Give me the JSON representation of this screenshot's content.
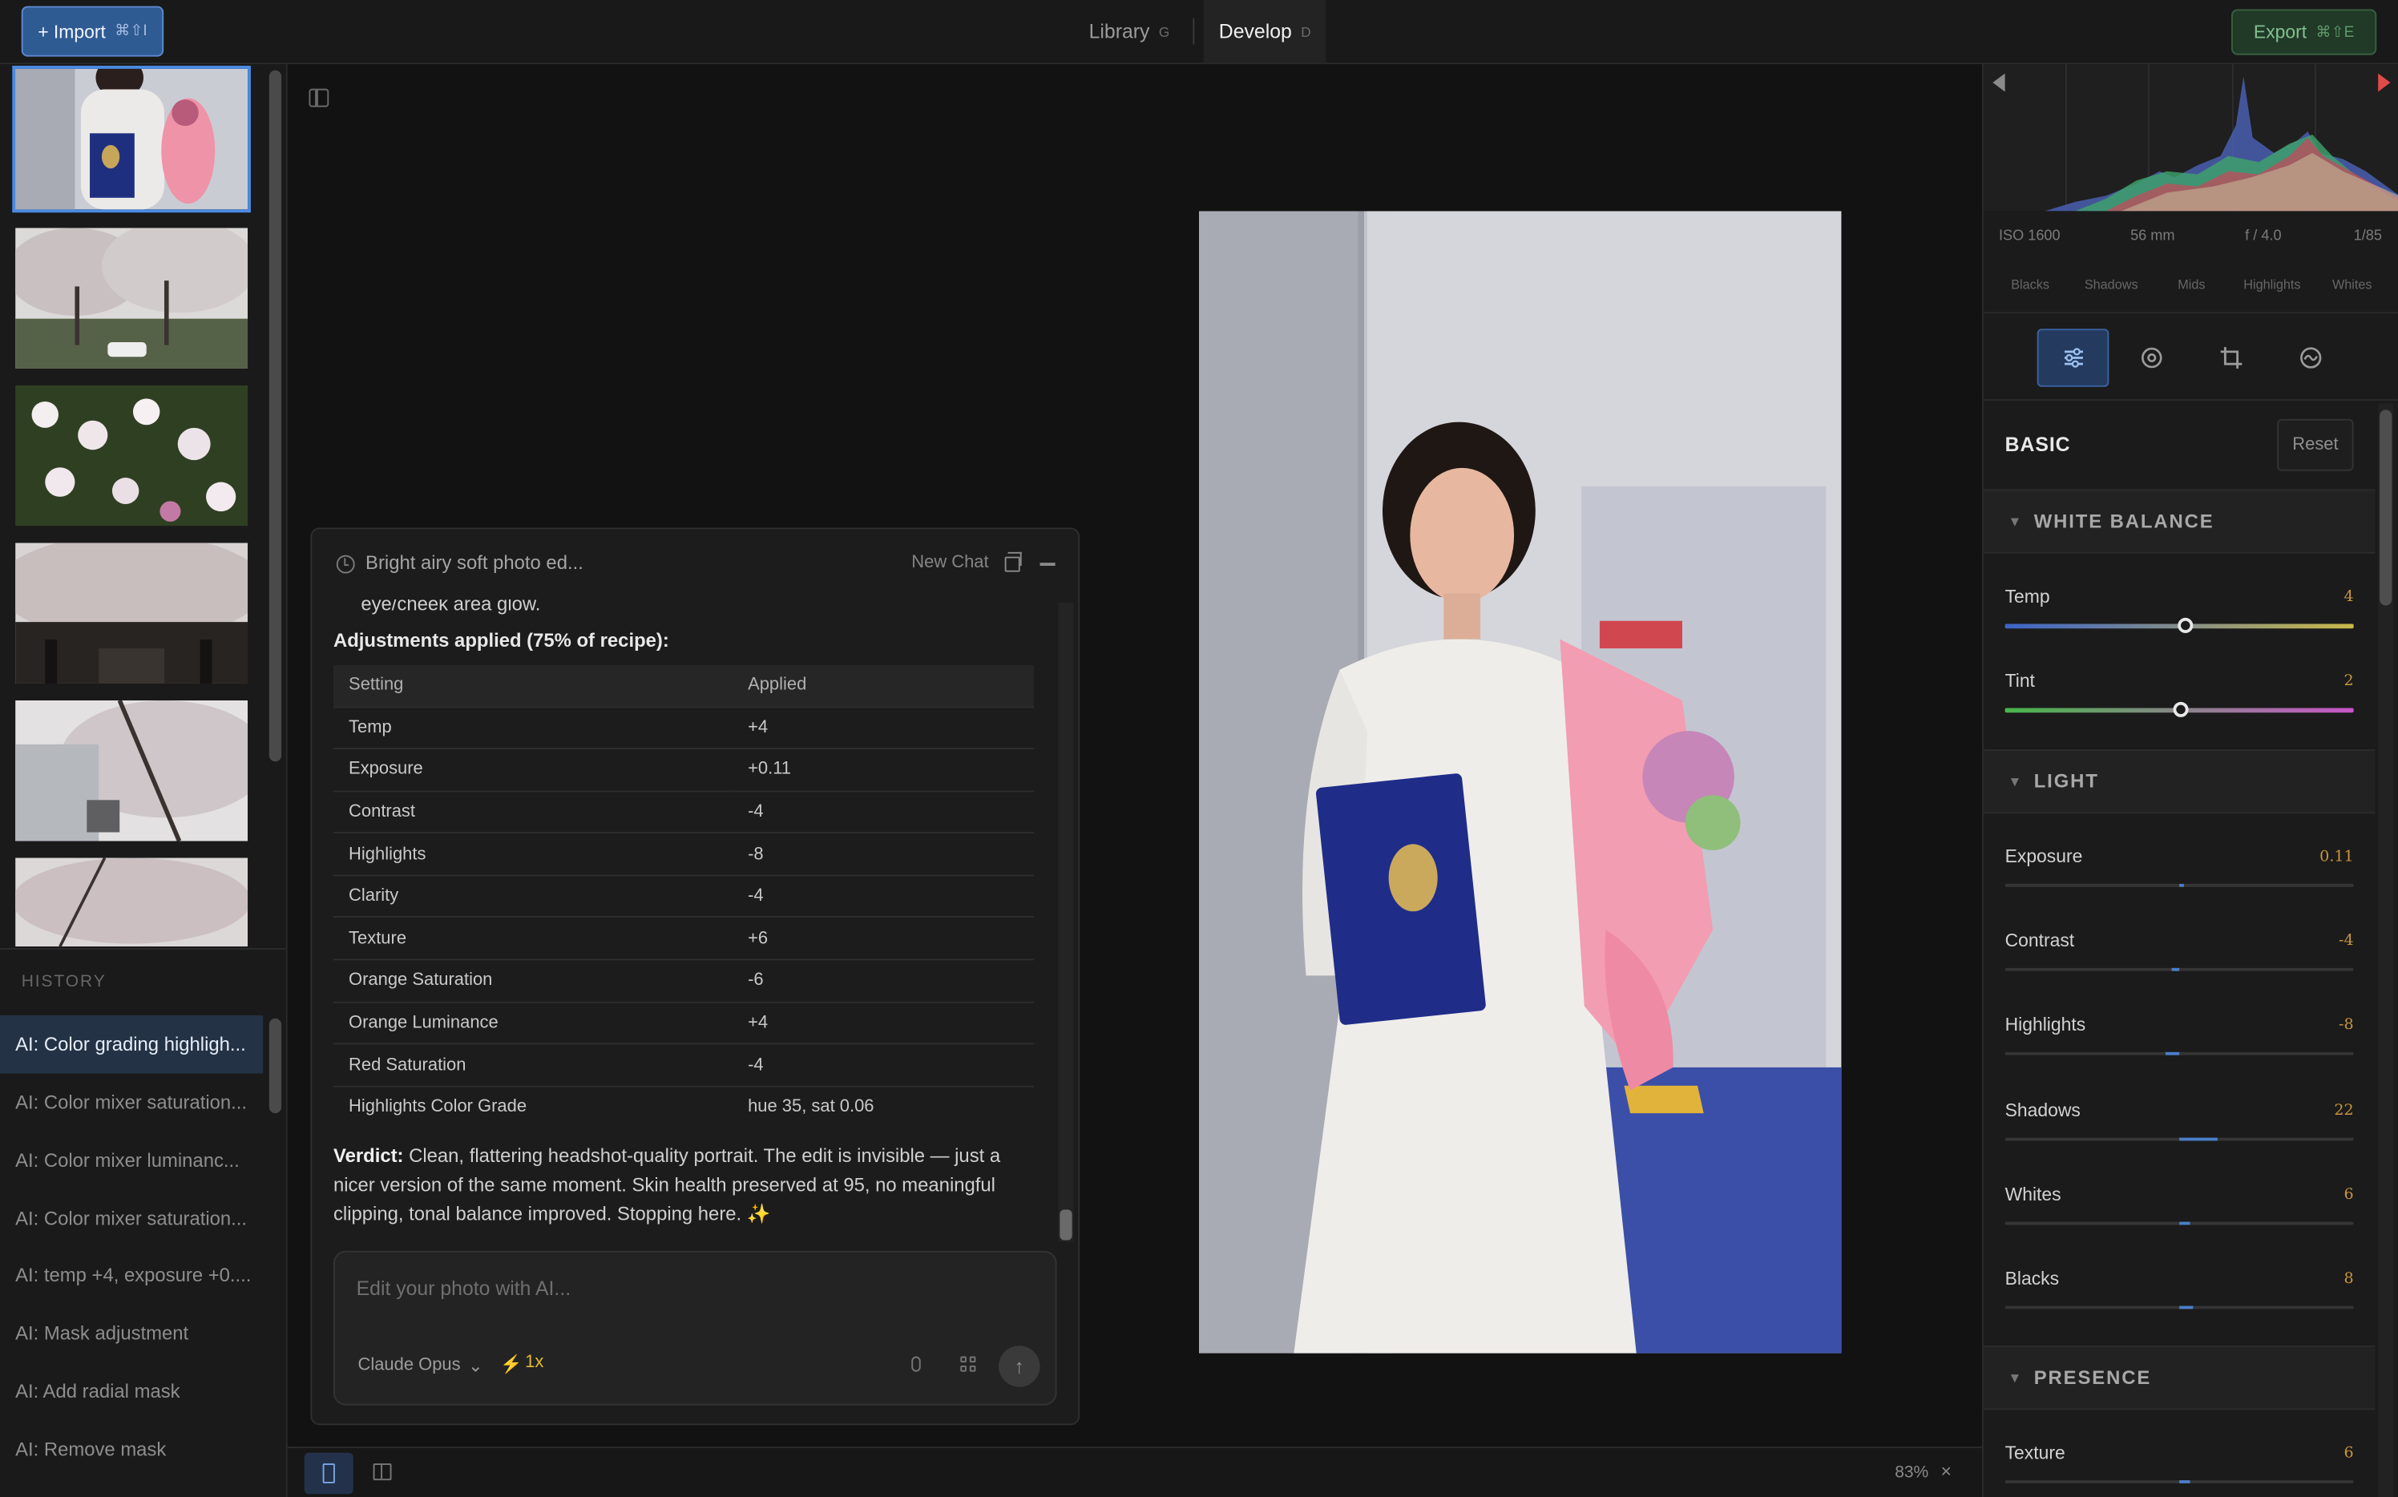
{
  "topbar": {
    "import_label": "+ Import",
    "import_shortcut": "⌘⇧I",
    "tabs": [
      {
        "label": "Library",
        "shortcut": "G"
      },
      {
        "label": "Develop",
        "shortcut": "D"
      }
    ],
    "export_label": "Export",
    "export_shortcut": "⌘⇧E"
  },
  "history": {
    "title": "HISTORY",
    "items": [
      "AI: Color grading highligh...",
      "AI: Color mixer saturation...",
      "AI: Color mixer luminanc...",
      "AI: Color mixer saturation...",
      "AI: temp +4, exposure +0....",
      "AI: Mask adjustment",
      "AI: Add radial mask",
      "AI: Remove mask"
    ]
  },
  "chat": {
    "title": "Bright airy soft photo ed...",
    "new_chat_label": "New Chat",
    "clipped_line": "eye/cheek area glow.",
    "adjustments_title": "Adjustments applied (75% of recipe):",
    "table_headers": [
      "Setting",
      "Applied"
    ],
    "table_rows": [
      [
        "Temp",
        "+4"
      ],
      [
        "Exposure",
        "+0.11"
      ],
      [
        "Contrast",
        "-4"
      ],
      [
        "Highlights",
        "-8"
      ],
      [
        "Clarity",
        "-4"
      ],
      [
        "Texture",
        "+6"
      ],
      [
        "Orange Saturation",
        "-6"
      ],
      [
        "Orange Luminance",
        "+4"
      ],
      [
        "Red Saturation",
        "-4"
      ],
      [
        "Highlights Color Grade",
        "hue 35, sat 0.06"
      ]
    ],
    "verdict_label": "Verdict:",
    "verdict_text": " Clean, flattering headshot-quality portrait. The edit is invisible — just a nicer version of the same moment. Skin health preserved at 95, no meaningful clipping, tonal balance improved. Stopping here. ✨",
    "input_placeholder": "Edit your photo with AI...",
    "model_label": "Claude Opus",
    "speed_label": "1x"
  },
  "bottombar": {
    "zoom": "83%",
    "close_glyph": "×"
  },
  "exif": {
    "iso": "ISO 1600",
    "focal": "56 mm",
    "aperture": "f / 4.0",
    "shutter": "1/85"
  },
  "tonal_labels": [
    "Blacks",
    "Shadows",
    "Mids",
    "Highlights",
    "Whites"
  ],
  "basic": {
    "title": "BASIC",
    "reset_label": "Reset"
  },
  "sections": {
    "white_balance": "WHITE BALANCE",
    "light": "LIGHT",
    "presence": "PRESENCE"
  },
  "sliders": {
    "temp": {
      "label": "Temp",
      "value": "4",
      "level": 0.52
    },
    "tint": {
      "label": "Tint",
      "value": "2",
      "level": 0.51
    },
    "exposure": {
      "label": "Exposure",
      "value": "0.11",
      "level": 0.511
    },
    "contrast": {
      "label": "Contrast",
      "value": "-4",
      "level": 0.48
    },
    "highlights": {
      "label": "Highlights",
      "value": "-8",
      "level": 0.46
    },
    "shadows": {
      "label": "Shadows",
      "value": "22",
      "level": 0.61
    },
    "whites": {
      "label": "Whites",
      "value": "6",
      "level": 0.53
    },
    "blacks": {
      "label": "Blacks",
      "value": "8",
      "level": 0.54
    },
    "texture": {
      "label": "Texture",
      "value": "6",
      "level": 0.53
    }
  },
  "colors": {
    "accent": "#4a8be4",
    "value_text": "#c9953c",
    "export_green": "#82c08f"
  }
}
